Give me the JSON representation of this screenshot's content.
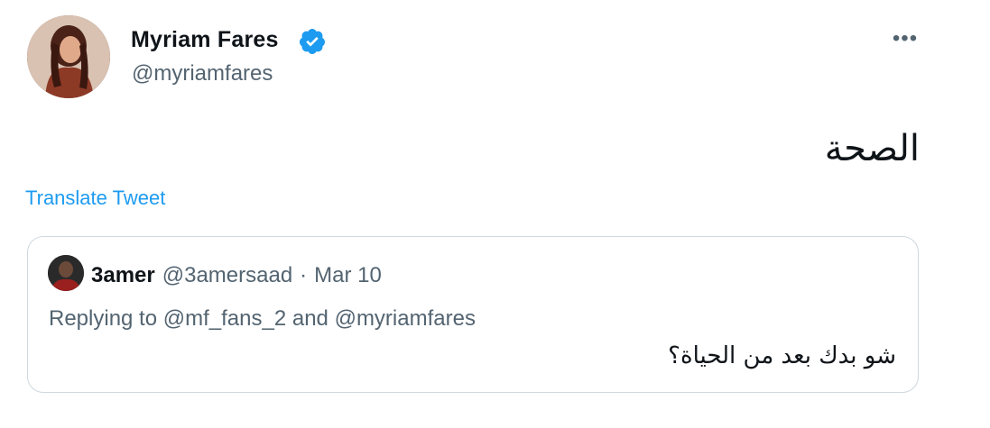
{
  "author": {
    "display_name": "Myriam Fares",
    "handle": "@myriamfares",
    "verified": true
  },
  "tweet": {
    "text": "الصحة",
    "translate_label": "Translate Tweet",
    "more_label": "•••"
  },
  "quoted_tweet": {
    "display_name": "3amer",
    "handle": "@3amersaad",
    "separator": "·",
    "date": "Mar 10",
    "replying_prefix": "Replying to",
    "replying_user_1": "@mf_fans_2",
    "replying_and": "and",
    "replying_user_2": "@myriamfares",
    "text": "شو بدك بعد من الحياة؟"
  },
  "colors": {
    "accent": "#1d9bf0",
    "muted": "#536471",
    "text": "#0f1419",
    "border": "#cfd9de"
  }
}
